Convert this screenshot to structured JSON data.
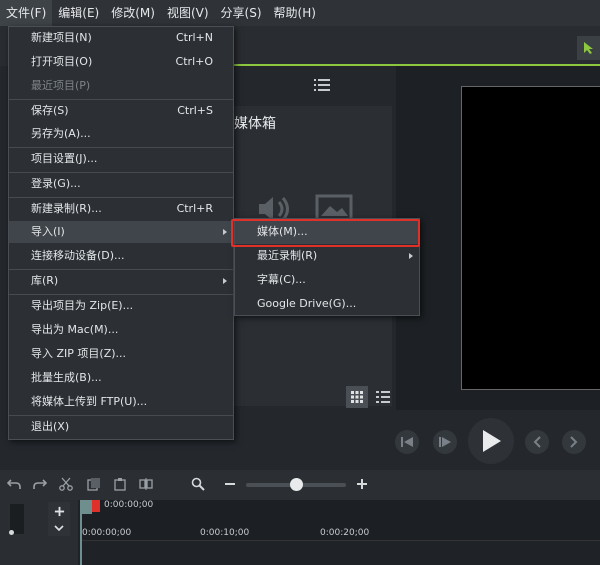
{
  "menubar": {
    "items": [
      "文件(F)",
      "编辑(E)",
      "修改(M)",
      "视图(V)",
      "分享(S)",
      "帮助(H)"
    ]
  },
  "media_bin": {
    "title": "媒体箱"
  },
  "file_menu": {
    "new_project": "新建项目(N)",
    "new_project_sc": "Ctrl+N",
    "open_project": "打开项目(O)",
    "open_project_sc": "Ctrl+O",
    "recent_projects": "最近项目(P)",
    "save": "保存(S)",
    "save_sc": "Ctrl+S",
    "save_as": "另存为(A)...",
    "project_settings": "项目设置(J)...",
    "login": "登录(G)...",
    "new_recording": "新建录制(R)...",
    "new_recording_sc": "Ctrl+R",
    "import": "导入(I)",
    "connect_mobile": "连接移动设备(D)...",
    "library": "库(R)",
    "export_zip": "导出项目为 Zip(E)...",
    "export_mac": "导出为 Mac(M)...",
    "import_zip": "导入 ZIP 项目(Z)...",
    "batch": "批量生成(B)...",
    "upload_ftp": "将媒体上传到 FTP(U)...",
    "exit": "退出(X)"
  },
  "import_submenu": {
    "media": "媒体(M)...",
    "recent_recordings": "最近录制(R)",
    "captions": "字幕(C)...",
    "google_drive": "Google Drive(G)..."
  },
  "timeline": {
    "playhead_time": "0:00:00;00",
    "ruler_0": "0:00:00;00",
    "ruler_10": "0:00:10;00",
    "ruler_20": "0:00:20;00"
  },
  "colors": {
    "accent": "#8dc63f",
    "highlight_box": "#e0302a",
    "menu_bg": "#2c3035"
  }
}
